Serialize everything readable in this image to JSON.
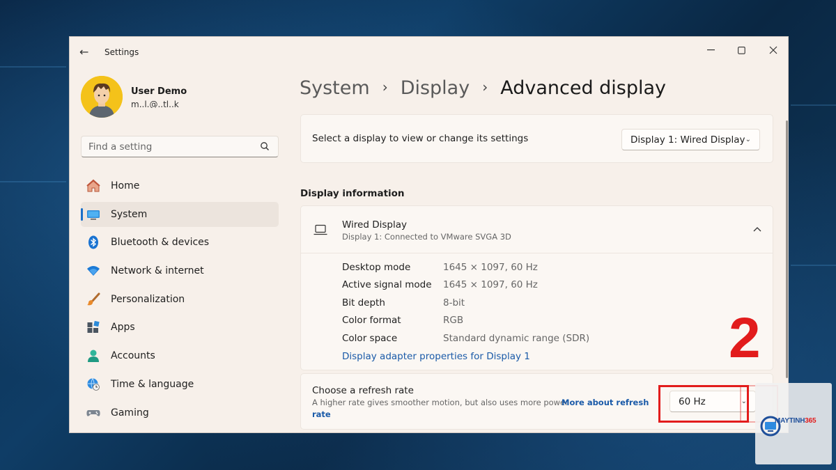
{
  "window": {
    "title": "Settings"
  },
  "user": {
    "name": "User Demo",
    "email": "m..l.@..tl..k"
  },
  "search": {
    "placeholder": "Find a setting"
  },
  "sidebar": {
    "items": [
      {
        "label": "Home",
        "icon": "home-icon",
        "active": false
      },
      {
        "label": "System",
        "icon": "system-monitor-icon",
        "active": true
      },
      {
        "label": "Bluetooth & devices",
        "icon": "bluetooth-icon",
        "active": false
      },
      {
        "label": "Network & internet",
        "icon": "wifi-icon",
        "active": false
      },
      {
        "label": "Personalization",
        "icon": "brush-icon",
        "active": false
      },
      {
        "label": "Apps",
        "icon": "apps-icon",
        "active": false
      },
      {
        "label": "Accounts",
        "icon": "accounts-icon",
        "active": false
      },
      {
        "label": "Time & language",
        "icon": "globe-clock-icon",
        "active": false
      },
      {
        "label": "Gaming",
        "icon": "gamepad-icon",
        "active": false
      }
    ]
  },
  "breadcrumb": {
    "level1": "System",
    "level2": "Display",
    "current": "Advanced display",
    "separator": "›"
  },
  "display_select": {
    "label": "Select a display to view or change its settings",
    "value": "Display 1: Wired Display"
  },
  "display_info": {
    "section_title": "Display information",
    "name": "Wired Display",
    "subtitle": "Display 1: Connected to VMware SVGA 3D",
    "rows": [
      {
        "label": "Desktop mode",
        "value": "1645 × 1097, 60 Hz"
      },
      {
        "label": "Active signal mode",
        "value": "1645 × 1097, 60 Hz"
      },
      {
        "label": "Bit depth",
        "value": "8-bit"
      },
      {
        "label": "Color format",
        "value": "RGB"
      },
      {
        "label": "Color space",
        "value": "Standard dynamic range (SDR)"
      }
    ],
    "adapter_link": "Display adapter properties for Display 1"
  },
  "refresh_rate": {
    "title": "Choose a refresh rate",
    "description": "A higher rate gives smoother motion, but also uses more power",
    "link_part1": "More about refresh",
    "link_part2": "rate",
    "value": "60 Hz"
  },
  "annotation": {
    "step_number": "2",
    "color": "#e21c1c"
  },
  "watermark": {
    "brand_a": "MAYTINH",
    "brand_b": "365"
  },
  "colors": {
    "accent": "#1a6fc8",
    "window_bg": "#f7f0ea",
    "link": "#1a5aa8"
  }
}
